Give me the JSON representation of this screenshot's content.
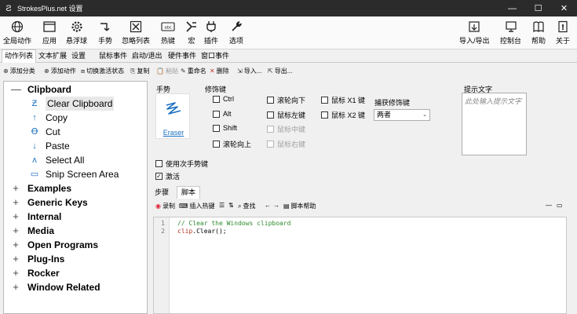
{
  "window": {
    "title": "StrokesPlus.net 设置",
    "controls": [
      "—",
      "☐",
      "✕"
    ]
  },
  "toolbar": {
    "left": [
      {
        "label": "全局动作",
        "icon": "globe-icon"
      },
      {
        "label": "应用",
        "icon": "window-icon"
      },
      {
        "label": "悬浮球",
        "icon": "gear-icon"
      },
      {
        "label": "手势",
        "icon": "gesture-icon"
      },
      {
        "label": "忽略列表",
        "icon": "ignore-icon"
      },
      {
        "label": "热键",
        "icon": "keyboard-icon"
      },
      {
        "label": "宏",
        "icon": "macro-icon"
      },
      {
        "label": "插件",
        "icon": "plugin-icon"
      },
      {
        "label": "选项",
        "icon": "wrench-icon"
      }
    ],
    "right": [
      {
        "label": "导入/导出",
        "icon": "import-export-icon"
      },
      {
        "label": "控制台",
        "icon": "console-icon"
      },
      {
        "label": "帮助",
        "icon": "help-icon"
      },
      {
        "label": "关于",
        "icon": "info-icon"
      }
    ]
  },
  "tabs": [
    "动作列表",
    "文本扩展",
    "设置",
    "鼠标事件",
    "启动/退出",
    "硬件事件",
    "窗口事件"
  ],
  "actions": [
    {
      "label": "添加分类",
      "icon": "add-category-icon",
      "enabled": true
    },
    {
      "label": "切换激活状态",
      "icon": "toggle-icon",
      "enabled": true
    },
    {
      "label": "复制",
      "icon": "copy-icon",
      "enabled": true
    },
    {
      "label": "粘贴",
      "icon": "paste-icon",
      "enabled": false
    },
    {
      "label": "重命名",
      "icon": "rename-icon",
      "enabled": true
    },
    {
      "label": "删除",
      "icon": "delete-icon",
      "enabled": true
    },
    {
      "label": "导入...",
      "icon": "import-icon",
      "enabled": true
    },
    {
      "label": "导出...",
      "icon": "export-icon",
      "enabled": true
    }
  ],
  "actions_extra": {
    "label": "添加动作",
    "icon": "add-action-icon"
  },
  "tree": {
    "root": {
      "label": "Clipboard",
      "expander": "—"
    },
    "children": [
      {
        "label": "Clear Clipboard",
        "icon": "gesture-z-icon",
        "glyph": "Ƶ",
        "selected": true
      },
      {
        "label": "Copy",
        "icon": "arrow-up-icon",
        "glyph": "↑"
      },
      {
        "label": "Cut",
        "icon": "cut-gesture-icon",
        "glyph": "Ꝋ"
      },
      {
        "label": "Paste",
        "icon": "arrow-down-icon",
        "glyph": "↓"
      },
      {
        "label": "Select All",
        "icon": "gesture-a-icon",
        "glyph": "ʌ"
      },
      {
        "label": "Snip Screen Area",
        "icon": "snip-icon",
        "glyph": "▭"
      }
    ],
    "groups": [
      "Examples",
      "Generic Keys",
      "Internal",
      "Media",
      "Open Programs",
      "Plug-Ins",
      "Rocker",
      "Window Related"
    ],
    "group_expander": "+"
  },
  "detail": {
    "gesture_label": "手势",
    "gesture_name": "Eraser",
    "modifier_label": "修饰键",
    "modifiers_col1": [
      {
        "label": "Ctrl",
        "checked": false,
        "enabled": true
      },
      {
        "label": "Alt",
        "checked": false,
        "enabled": true
      },
      {
        "label": "Shift",
        "checked": false,
        "enabled": true
      },
      {
        "label": "滚轮向上",
        "checked": false,
        "enabled": true
      }
    ],
    "modifiers_col2": [
      {
        "label": "滚轮向下",
        "checked": false,
        "enabled": true
      },
      {
        "label": "鼠标左键",
        "checked": false,
        "enabled": true
      },
      {
        "label": "鼠标中键",
        "checked": false,
        "enabled": false
      },
      {
        "label": "鼠标右键",
        "checked": false,
        "enabled": false
      }
    ],
    "modifiers_col3": [
      {
        "label": "鼠标 X1 键",
        "checked": false,
        "enabled": true
      },
      {
        "label": "鼠标 X2 键",
        "checked": false,
        "enabled": true
      }
    ],
    "capture_label": "捕获修饰键",
    "capture_value": "两者",
    "tip_label": "提示文字",
    "tip_placeholder": "此处输入提示文字",
    "use_secondary": {
      "label": "使用次手势键",
      "checked": false
    },
    "activate": {
      "label": "激活",
      "checked": true
    },
    "subtabs": [
      "步骤",
      "脚本"
    ],
    "editor_tools": [
      {
        "label": "录制",
        "icon": "record-icon"
      },
      {
        "label": "插入热键",
        "icon": "insert-hotkey-icon"
      },
      {
        "label": "",
        "icon": "list-icon"
      },
      {
        "label": "",
        "icon": "sort-icon"
      },
      {
        "label": "查找",
        "icon": "search-icon"
      },
      {
        "label": "",
        "icon": "back-icon"
      },
      {
        "label": "",
        "icon": "forward-icon"
      },
      {
        "label": "脚本帮助",
        "icon": "script-help-icon"
      }
    ],
    "editor_win": [
      "—",
      "▭"
    ],
    "code": {
      "line_numbers": [
        "1",
        "2"
      ],
      "line1": "// Clear the Windows clipboard",
      "line2_kw": "clip",
      "line2_rest": ".Clear();"
    }
  }
}
